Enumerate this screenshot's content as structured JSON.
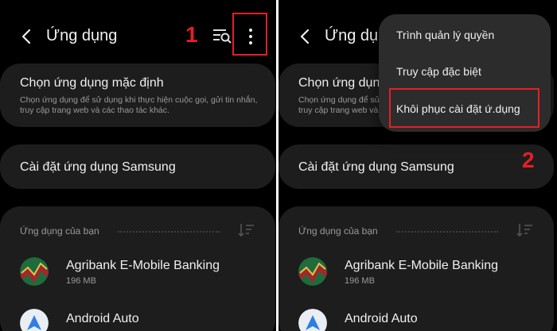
{
  "header": {
    "title": "Ứng dụng"
  },
  "steps": {
    "one": "1",
    "two": "2"
  },
  "default_apps": {
    "title": "Chọn ứng dụng mặc định",
    "description": "Chọn ứng dụng để sử dụng khi thực hiện cuộc gọi, gửi tin nhắn, truy cập trang web và các thao tác khác."
  },
  "samsung_settings": {
    "title": "Cài đặt ứng dụng Samsung"
  },
  "your_apps": {
    "section_title": "Ứng dụng của bạn",
    "items": [
      {
        "name": "Agribank E-Mobile Banking",
        "size": "196 MB"
      },
      {
        "name": "Android Auto",
        "size": ""
      }
    ]
  },
  "overflow_menu": {
    "items": [
      {
        "label": "Trình quản lý quyền"
      },
      {
        "label": "Truy cập đặc biệt"
      },
      {
        "label": "Khôi phục cài đặt ứ.dụng"
      }
    ]
  },
  "colors": {
    "highlight": "#e41f26",
    "background": "#000000",
    "card": "#1d1d1d",
    "menu": "#2c2c2c"
  },
  "icons": [
    "back-arrow-icon",
    "search-list-icon",
    "more-options-icon",
    "sort-icon",
    "agribank-app-icon",
    "android-auto-app-icon"
  ]
}
